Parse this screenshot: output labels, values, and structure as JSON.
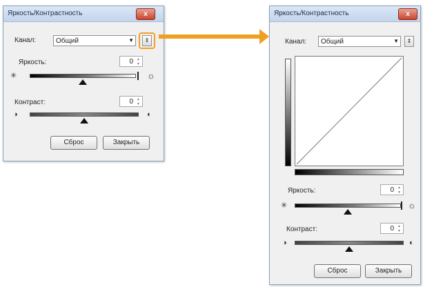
{
  "small_dialog": {
    "title": "Яркость/Контрастность",
    "close_label": "x",
    "channel_label": "Канал:",
    "channel_value": "Общий",
    "expand_icon": "expand-icon",
    "brightness_label": "Яркость:",
    "brightness_value": "0",
    "contrast_label": "Контраст:",
    "contrast_value": "0",
    "reset_label": "Сброс",
    "close_button_label": "Закрыть"
  },
  "large_dialog": {
    "title": "Яркость/Контрастность",
    "close_label": "x",
    "channel_label": "Канал:",
    "channel_value": "Общий",
    "brightness_label": "Яркость:",
    "brightness_value": "0",
    "contrast_label": "Контраст:",
    "contrast_value": "0",
    "reset_label": "Сброс",
    "close_button_label": "Закрыть"
  },
  "colors": {
    "highlight": "#f0a020",
    "close_red": "#c7452f"
  },
  "sliders": {
    "brightness_level": 0.5,
    "contrast_level": 0.5
  }
}
